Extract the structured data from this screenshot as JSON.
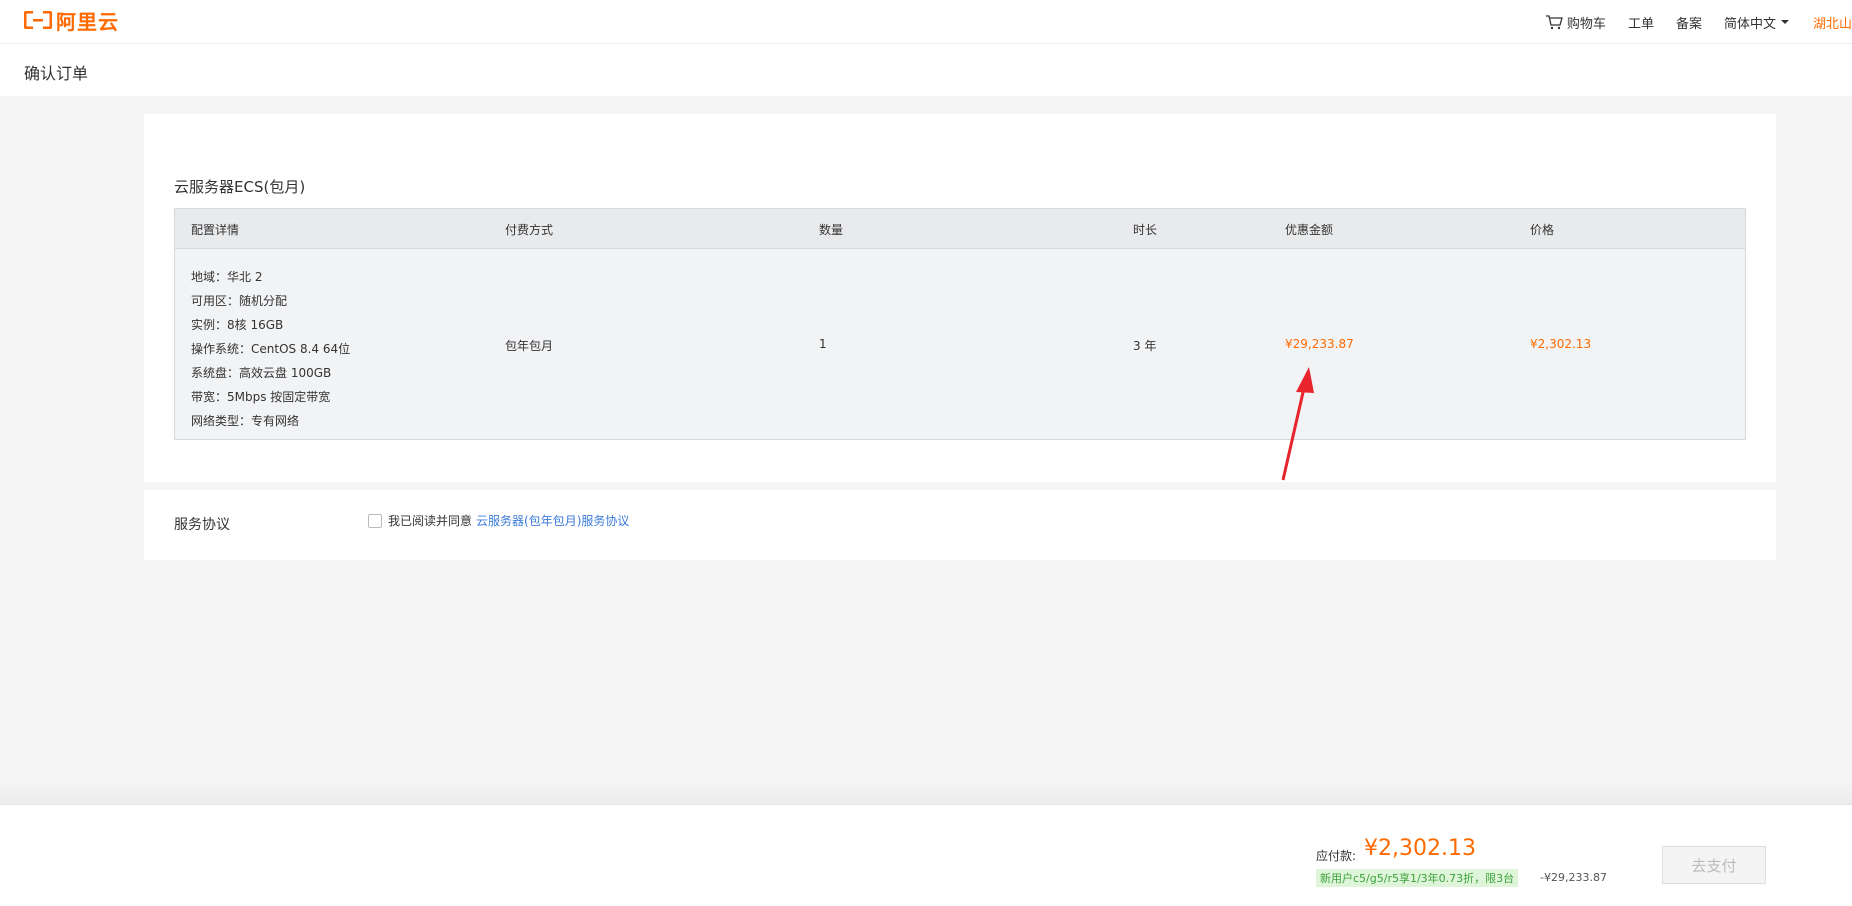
{
  "header": {
    "logo_text": "阿里云",
    "nav": {
      "cart": "购物车",
      "ticket": "工单",
      "filing": "备案",
      "language": "简体中文",
      "user": "湖北山"
    }
  },
  "page": {
    "title": "确认订单"
  },
  "order": {
    "section_title": "云服务器ECS(包月)",
    "columns": [
      "配置详情",
      "付费方式",
      "数量",
      "时长",
      "优惠金额",
      "价格"
    ],
    "row": {
      "details": [
        "地域：华北 2",
        "可用区：随机分配",
        "实例：8核 16GB",
        "操作系统：CentOS 8.4 64位",
        "系统盘：高效云盘 100GB",
        "带宽：5Mbps 按固定带宽",
        "网络类型：专有网络"
      ],
      "payment": "包年包月",
      "quantity": "1",
      "duration": "3 年",
      "discount": "¥29,233.87",
      "price": "¥2,302.13"
    }
  },
  "agreement": {
    "label": "服务协议",
    "checkbox_text": "我已阅读并同意",
    "link_text": "云服务器(包年包月)服务协议"
  },
  "footer": {
    "pay_label": "应付款:",
    "pay_amount": "¥2,302.13",
    "promo_text": "新用户c5/g5/r5享1/3年0.73折，限3台",
    "promo_amount": "-¥29,233.87",
    "pay_button": "去支付"
  },
  "colors": {
    "brand": "#ff6a00",
    "link": "#3b7ad9",
    "promo_bg": "#dff5d9",
    "promo_text": "#3ca23c",
    "annotation_arrow": "#e8242c"
  }
}
